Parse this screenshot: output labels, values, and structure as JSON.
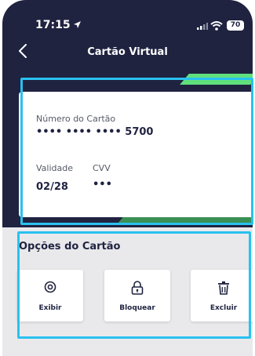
{
  "status_bar": {
    "time": "17:15",
    "battery": "70"
  },
  "nav": {
    "title": "Cartão Virtual"
  },
  "card": {
    "number_label": "Número do Cartão",
    "number_value": "•••• •••• •••• 5700",
    "validity_label": "Validade",
    "validity_value": "02/28",
    "cvv_label": "CVV",
    "cvv_value": "•••"
  },
  "options": {
    "title": "Opções do Cartão",
    "buttons": [
      {
        "label": "Exibir",
        "icon": "eye-icon"
      },
      {
        "label": "Bloquear",
        "icon": "lock-icon"
      },
      {
        "label": "Excluir",
        "icon": "trash-icon"
      }
    ]
  },
  "colors": {
    "header_background": "#1f2340",
    "accent_green": "#5fe07d",
    "highlight_blue": "#29c1f0"
  }
}
